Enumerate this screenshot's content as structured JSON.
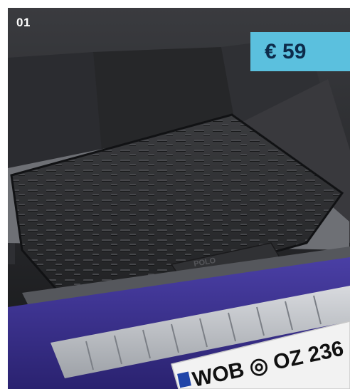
{
  "image": {
    "description_label": "car-trunk-cargo-mat-photo",
    "badge_number": "01",
    "price": "€ 59",
    "mat_embossing": "POLO",
    "license_plate_text": "WOB ◎ OZ 236"
  },
  "colors": {
    "price_box": "#5bc0de",
    "price_text": "#0d2b4a",
    "car_paint": "#3b2f8f",
    "mat": "#2a2b2d"
  }
}
